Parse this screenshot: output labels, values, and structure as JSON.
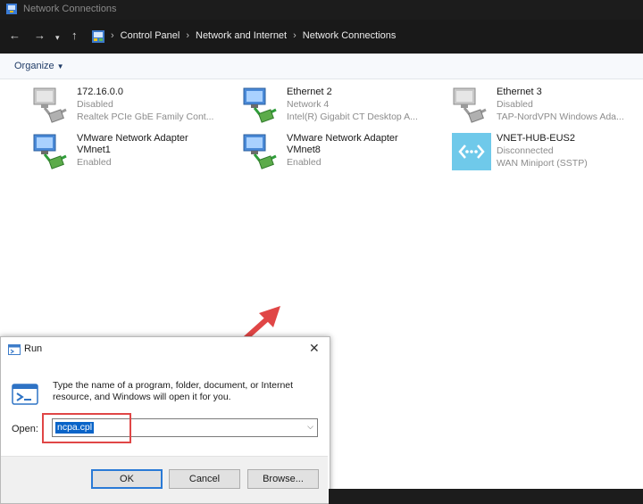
{
  "window": {
    "title": "Network Connections"
  },
  "address": {
    "back_icon": "←",
    "forward_icon": "→",
    "recent_icon": "▾",
    "up_icon": "↑",
    "crumbs": [
      "Control Panel",
      "Network and Internet",
      "Network Connections"
    ],
    "separator": "›"
  },
  "command_bar": {
    "organize_label": "Organize"
  },
  "connections": [
    {
      "name": "172.16.0.0",
      "status": "Disabled",
      "device": "Realtek PCIe GbE Family Cont...",
      "icon": "network-adapter-disabled-icon"
    },
    {
      "name": "Ethernet 2",
      "status": "Network 4",
      "device": "Intel(R) Gigabit CT Desktop A...",
      "icon": "network-adapter-icon"
    },
    {
      "name": "Ethernet 3",
      "status": "Disabled",
      "device": "TAP-NordVPN Windows Ada...",
      "icon": "network-adapter-disabled-icon"
    },
    {
      "name": "VMware Network Adapter",
      "name2": "VMnet1",
      "status": "Enabled",
      "icon": "network-adapter-icon"
    },
    {
      "name": "VMware Network Adapter",
      "name2": "VMnet8",
      "status": "Enabled",
      "icon": "network-adapter-icon"
    },
    {
      "name": "VNET-HUB-EUS2",
      "status": "Disconnected",
      "device": "WAN Miniport (SSTP)",
      "icon": "vpn-connection-icon"
    }
  ],
  "run_dialog": {
    "title": "Run",
    "close_icon": "✕",
    "description": "Type the name of a program, folder, document, or Internet resource, and Windows will open it for you.",
    "open_label": "Open:",
    "open_value": "ncpa.cpl",
    "dropdown_icon": "⌵",
    "ok_label": "OK",
    "cancel_label": "Cancel",
    "browse_label": "Browse..."
  },
  "colors": {
    "accent": "#0a64c8",
    "highlight": "#e04646",
    "titlebar": "#1c1c1c"
  }
}
